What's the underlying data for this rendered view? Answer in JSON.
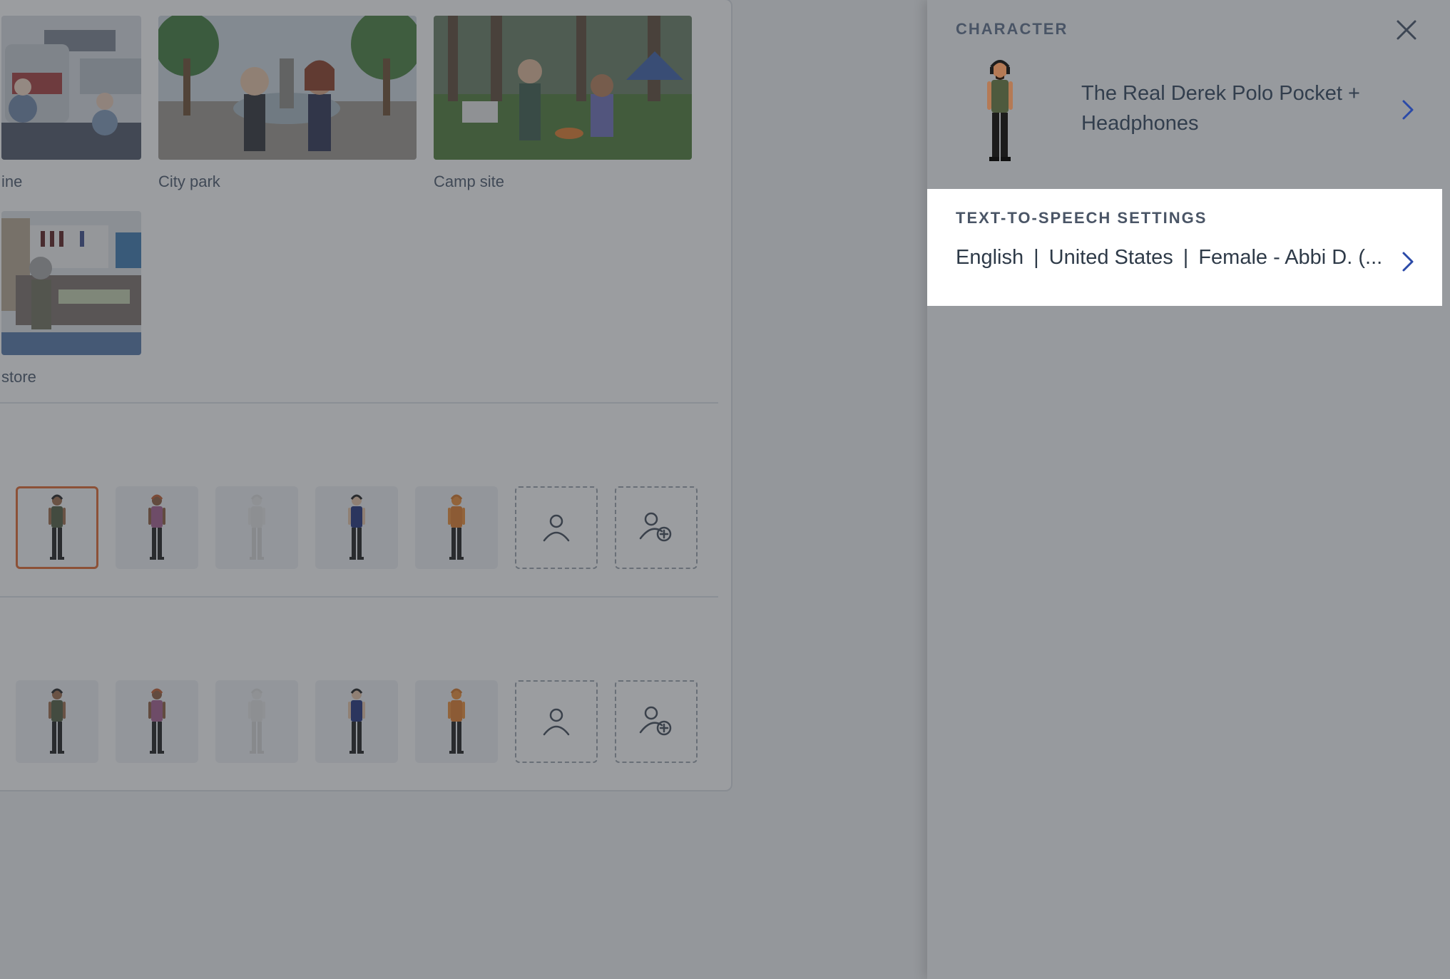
{
  "scenes": [
    {
      "label": "ine"
    },
    {
      "label": "City park"
    },
    {
      "label": "Camp site"
    },
    {
      "label": "store"
    }
  ],
  "character_rows": [
    {
      "row": 1,
      "tiles": [
        "character-1",
        "character-2",
        "character-3",
        "character-4",
        "character-5",
        "character-placeholder",
        "add-character"
      ]
    },
    {
      "row": 2,
      "tiles": [
        "character-1",
        "character-2",
        "character-3",
        "character-4",
        "character-5",
        "character-placeholder",
        "add-character"
      ]
    }
  ],
  "panel": {
    "character_label": "CHARACTER",
    "character_name": "The Real Derek Polo Pocket + Headphones",
    "tts_label": "TEXT-TO-SPEECH SETTINGS",
    "tts_language": "English",
    "tts_region": "United States",
    "tts_voice": "Female - Abbi D. (...",
    "separator": "|"
  },
  "colors": {
    "selected_border": "#e0672d",
    "chevron": "#2b4aa8",
    "overlay": "rgba(56,60,66,0.50)"
  },
  "icons": [
    "close-icon",
    "chevron-right-icon",
    "person-icon",
    "person-add-icon"
  ]
}
